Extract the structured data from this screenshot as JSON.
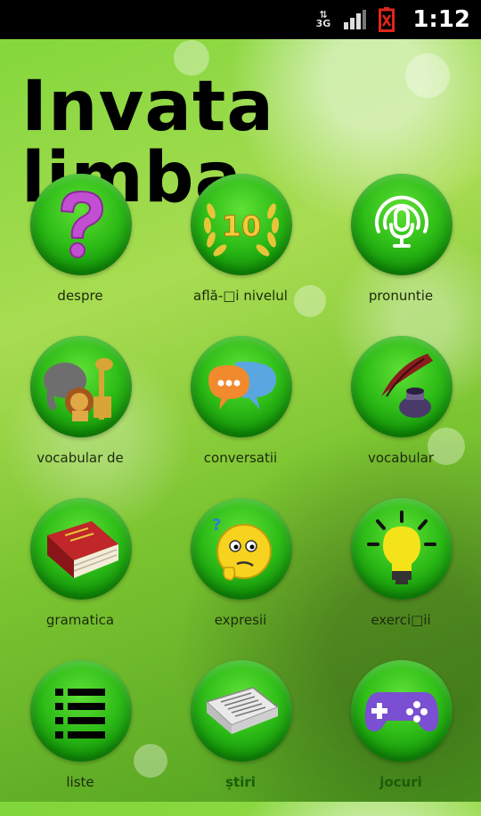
{
  "status": {
    "network": "3G",
    "time": "1:12"
  },
  "title": "Invata limba",
  "menu": [
    {
      "label": "despre",
      "icon": "question-icon"
    },
    {
      "label": "află-□i nivelul",
      "icon": "laurel-10-icon"
    },
    {
      "label": "pronuntie",
      "icon": "microphone-icon"
    },
    {
      "label": "vocabular de",
      "icon": "animals-icon"
    },
    {
      "label": "conversatii",
      "icon": "speech-bubbles-icon"
    },
    {
      "label": "vocabular",
      "icon": "quill-ink-icon"
    },
    {
      "label": "gramatica",
      "icon": "book-icon"
    },
    {
      "label": "expresii",
      "icon": "thinking-face-icon"
    },
    {
      "label": "exerci□ii",
      "icon": "lightbulb-icon"
    },
    {
      "label": "liste",
      "icon": "list-icon"
    },
    {
      "label": "știri",
      "icon": "newspaper-icon"
    },
    {
      "label": "jocuri",
      "icon": "gamepad-icon"
    }
  ],
  "colors": {
    "accent_green": "#2fbd18",
    "background_green": "#8fd13f"
  }
}
